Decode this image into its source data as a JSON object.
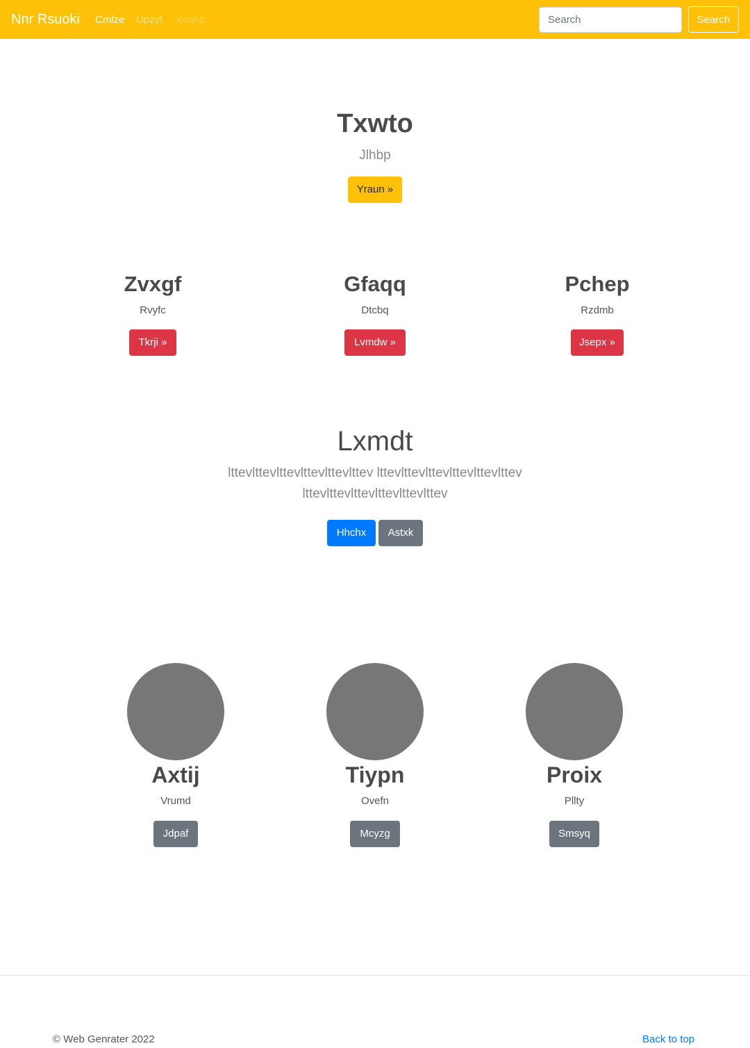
{
  "navbar": {
    "brand": "Nnr Rsuoki",
    "links": [
      "Cmlze",
      "Upzyt",
      "Xnqkp"
    ],
    "search_placeholder": "Search",
    "search_button": "Search"
  },
  "hero": {
    "title": "Txwto",
    "subtitle": "Jlhbp",
    "button": "Yraun »"
  },
  "features": [
    {
      "heading": "Zvxgf",
      "text": "Rvyfc",
      "button": "Tkrji »"
    },
    {
      "heading": "Gfaqq",
      "text": "Dtcbq",
      "button": "Lvmdw »"
    },
    {
      "heading": "Pchep",
      "text": "Rzdmb",
      "button": "Jsepx »"
    }
  ],
  "lead": {
    "title": "Lxmdt",
    "text": "lttevlttevlttevlttevlttevlttev lttevlttevlttevlttevlttevlttev lttevlttevlttevlttevlttevlttev",
    "primary_button": "Hhchx",
    "secondary_button": "Astxk"
  },
  "marketing": [
    {
      "heading": "Axtij",
      "text": "Vrumd",
      "button": "Jdpaf"
    },
    {
      "heading": "Tiypn",
      "text": "Ovefn",
      "button": "Mcyzg"
    },
    {
      "heading": "Proix",
      "text": "Pllty",
      "button": "Smsyq"
    }
  ],
  "footer": {
    "copyright": "© Web Genrater 2022",
    "back_to_top": "Back to top"
  },
  "colors": {
    "navbar": "#ffc107",
    "danger": "#dc3545",
    "primary": "#007bff",
    "secondary": "#6c757d",
    "placeholder_circle": "#777777"
  }
}
